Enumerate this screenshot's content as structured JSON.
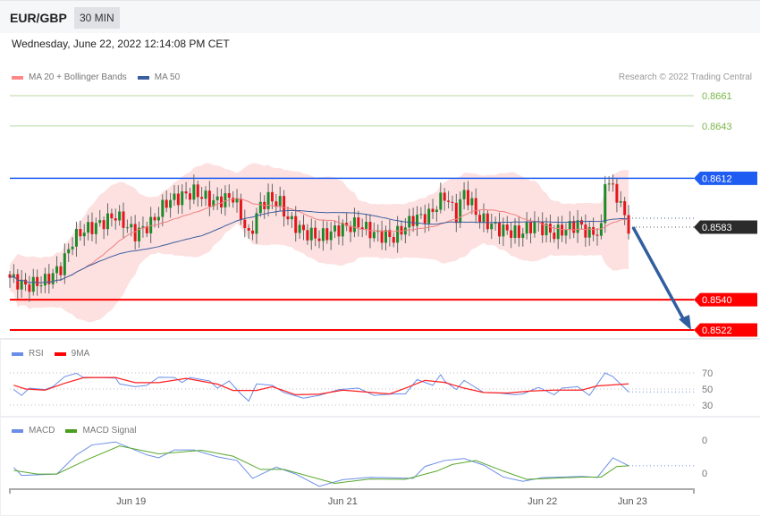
{
  "header": {
    "pair": "EUR/GBP",
    "timeframe": "30 MIN",
    "datetime": "Wednesday, June 22, 2022 12:14:08 PM CET"
  },
  "legend": {
    "ma20": "MA 20 + Bollinger Bands",
    "ma50": "MA 50",
    "rsi": "RSI",
    "rsi_ma": "9MA",
    "macd": "MACD",
    "macd_signal": "MACD Signal"
  },
  "copyright": "Research © 2022 Trading Central",
  "colors": {
    "up": "#1d8a2a",
    "down": "#e3161b",
    "ma20": "#f08080",
    "ma50": "#3b5e9e",
    "band": "#fde1e1",
    "support": "#ff0000",
    "resistance": "#1f5cf2",
    "target": "#7ab648",
    "arrow": "#2f5f9e",
    "rsi": "#6a8ee8",
    "rsi_ma": "#ff2020",
    "macd": "#6a8ee8",
    "signal": "#58a82a"
  },
  "chart_data": [
    {
      "type": "candlestick",
      "title": "EUR/GBP 30 MIN",
      "ylim": [
        0.8522,
        0.8661
      ],
      "bars": 159,
      "close_keypoints": [
        [
          0,
          0.8553
        ],
        [
          4,
          0.8548
        ],
        [
          9,
          0.8551
        ],
        [
          13,
          0.8559
        ],
        [
          16,
          0.8575
        ],
        [
          18,
          0.858
        ],
        [
          23,
          0.8585
        ],
        [
          27,
          0.859
        ],
        [
          32,
          0.8579
        ],
        [
          36,
          0.8585
        ],
        [
          40,
          0.8598
        ],
        [
          47,
          0.8604
        ],
        [
          52,
          0.8598
        ],
        [
          57,
          0.8601
        ],
        [
          59,
          0.859
        ],
        [
          61,
          0.8577
        ],
        [
          64,
          0.8596
        ],
        [
          66,
          0.86
        ],
        [
          69,
          0.8597
        ],
        [
          71,
          0.8588
        ],
        [
          75,
          0.858
        ],
        [
          79,
          0.8577
        ],
        [
          84,
          0.8582
        ],
        [
          89,
          0.8585
        ],
        [
          93,
          0.8579
        ],
        [
          98,
          0.8577
        ],
        [
          103,
          0.8588
        ],
        [
          107,
          0.859
        ],
        [
          111,
          0.8602
        ],
        [
          114,
          0.859
        ],
        [
          116,
          0.8604
        ],
        [
          120,
          0.8588
        ],
        [
          125,
          0.8582
        ],
        [
          130,
          0.8579
        ],
        [
          134,
          0.8585
        ],
        [
          139,
          0.8579
        ],
        [
          145,
          0.8585
        ],
        [
          148,
          0.8579
        ],
        [
          151,
          0.8581
        ],
        [
          152,
          0.8612
        ],
        [
          155,
          0.8602
        ],
        [
          158,
          0.8583
        ]
      ],
      "levels": [
        {
          "value": "0.8661",
          "kind": "target"
        },
        {
          "value": "0.8643",
          "kind": "target"
        },
        {
          "value": "0.8612",
          "kind": "resistance"
        },
        {
          "value": "0.8583",
          "kind": "last"
        },
        {
          "value": "0.8540",
          "kind": "support"
        },
        {
          "value": "0.8522",
          "kind": "support"
        }
      ],
      "x_ticks": [
        {
          "label": "Jun 19",
          "bar": 31
        },
        {
          "label": "Jun 21",
          "bar": 85
        },
        {
          "label": "Jun 22",
          "bar": 136
        },
        {
          "label": "Jun 23",
          "bar": 159
        }
      ]
    },
    {
      "type": "line",
      "title": "RSI",
      "ylim": [
        30,
        70
      ],
      "y_ticks": [
        "70",
        "50",
        "30"
      ],
      "series": [
        {
          "name": "RSI",
          "points": [
            [
              1,
              49.3
            ],
            [
              3,
              42.1
            ],
            [
              5,
              51.1
            ],
            [
              9,
              49.3
            ],
            [
              11,
              52.9
            ],
            [
              14,
              65.4
            ],
            [
              17,
              69.6
            ],
            [
              19,
              63.6
            ],
            [
              22,
              64.3
            ],
            [
              27,
              63.6
            ],
            [
              28,
              56.4
            ],
            [
              32,
              52.9
            ],
            [
              35,
              54.6
            ],
            [
              38,
              64.6
            ],
            [
              42,
              64.3
            ],
            [
              44,
              58.2
            ],
            [
              46,
              64.3
            ],
            [
              51,
              60
            ],
            [
              53,
              51.1
            ],
            [
              56,
              60
            ],
            [
              59,
              43.9
            ],
            [
              61,
              35
            ],
            [
              63,
              56.4
            ],
            [
              67,
              54.6
            ],
            [
              70,
              45.7
            ],
            [
              75,
              38.6
            ],
            [
              79,
              42.1
            ],
            [
              84,
              49.3
            ],
            [
              89,
              51.1
            ],
            [
              93,
              42.1
            ],
            [
              98,
              43.9
            ],
            [
              101,
              43.9
            ],
            [
              104,
              61.8
            ],
            [
              108,
              54.6
            ],
            [
              110,
              67.9
            ],
            [
              111,
              60
            ],
            [
              114,
              49.3
            ],
            [
              116,
              60.7
            ],
            [
              121,
              45.7
            ],
            [
              125,
              45
            ],
            [
              129,
              42.9
            ],
            [
              131,
              43.9
            ],
            [
              135,
              52.1
            ],
            [
              139,
              42.9
            ],
            [
              141,
              51.1
            ],
            [
              145,
              52.9
            ],
            [
              148,
              42.1
            ],
            [
              152,
              70
            ],
            [
              154,
              65.4
            ],
            [
              158,
              46.4
            ]
          ]
        },
        {
          "name": "9MA",
          "points": [
            [
              1,
              54.6
            ],
            [
              4,
              50
            ],
            [
              9,
              48.6
            ],
            [
              14,
              57.1
            ],
            [
              19,
              64.3
            ],
            [
              27,
              64.3
            ],
            [
              32,
              57.9
            ],
            [
              38,
              57.9
            ],
            [
              45,
              63.2
            ],
            [
              53,
              56.1
            ],
            [
              57,
              48.2
            ],
            [
              63,
              48.2
            ],
            [
              67,
              52.9
            ],
            [
              73,
              42.9
            ],
            [
              79,
              43.6
            ],
            [
              85,
              48.6
            ],
            [
              97,
              43.9
            ],
            [
              101,
              51.1
            ],
            [
              106,
              60.7
            ],
            [
              111,
              58.2
            ],
            [
              116,
              51.1
            ],
            [
              121,
              45.7
            ],
            [
              127,
              45
            ],
            [
              133,
              47.5
            ],
            [
              139,
              48.6
            ],
            [
              146,
              48.6
            ],
            [
              150,
              53.9
            ],
            [
              158,
              56.4
            ]
          ]
        }
      ]
    },
    {
      "type": "line",
      "title": "MACD",
      "y_ticks": [
        "0",
        "0"
      ],
      "series": [
        {
          "name": "MACD",
          "points": [
            [
              1,
              0.17
            ],
            [
              3,
              -0.07
            ],
            [
              12,
              -0.03
            ],
            [
              17,
              0.55
            ],
            [
              21,
              0.85
            ],
            [
              27,
              0.94
            ],
            [
              35,
              0.55
            ],
            [
              38,
              0.46
            ],
            [
              42,
              0.7
            ],
            [
              47,
              0.7
            ],
            [
              53,
              0.49
            ],
            [
              58,
              0.38
            ],
            [
              62,
              -0.16
            ],
            [
              68,
              0.18
            ],
            [
              73,
              -0.03
            ],
            [
              79,
              -0.4
            ],
            [
              85,
              -0.2
            ],
            [
              92,
              -0.13
            ],
            [
              103,
              -0.16
            ],
            [
              106,
              0.2
            ],
            [
              111,
              0.38
            ],
            [
              116,
              0.44
            ],
            [
              121,
              0.24
            ],
            [
              126,
              -0.12
            ],
            [
              131,
              -0.25
            ],
            [
              136,
              -0.14
            ],
            [
              146,
              -0.1
            ],
            [
              150,
              -0.13
            ],
            [
              154,
              0.46
            ],
            [
              158,
              0.22
            ]
          ]
        },
        {
          "name": "MACD Signal",
          "points": [
            [
              1,
              0.08
            ],
            [
              7,
              -0.03
            ],
            [
              12,
              -0.03
            ],
            [
              20,
              0.42
            ],
            [
              28,
              0.82
            ],
            [
              38,
              0.58
            ],
            [
              49,
              0.69
            ],
            [
              57,
              0.51
            ],
            [
              64,
              0.11
            ],
            [
              70,
              0.11
            ],
            [
              83,
              -0.31
            ],
            [
              92,
              -0.18
            ],
            [
              101,
              -0.19
            ],
            [
              109,
              0.06
            ],
            [
              113,
              0.26
            ],
            [
              119,
              0.38
            ],
            [
              126,
              0.06
            ],
            [
              132,
              -0.19
            ],
            [
              146,
              -0.12
            ],
            [
              151,
              -0.12
            ],
            [
              155,
              0.2
            ],
            [
              158,
              0.22
            ]
          ]
        }
      ]
    }
  ]
}
